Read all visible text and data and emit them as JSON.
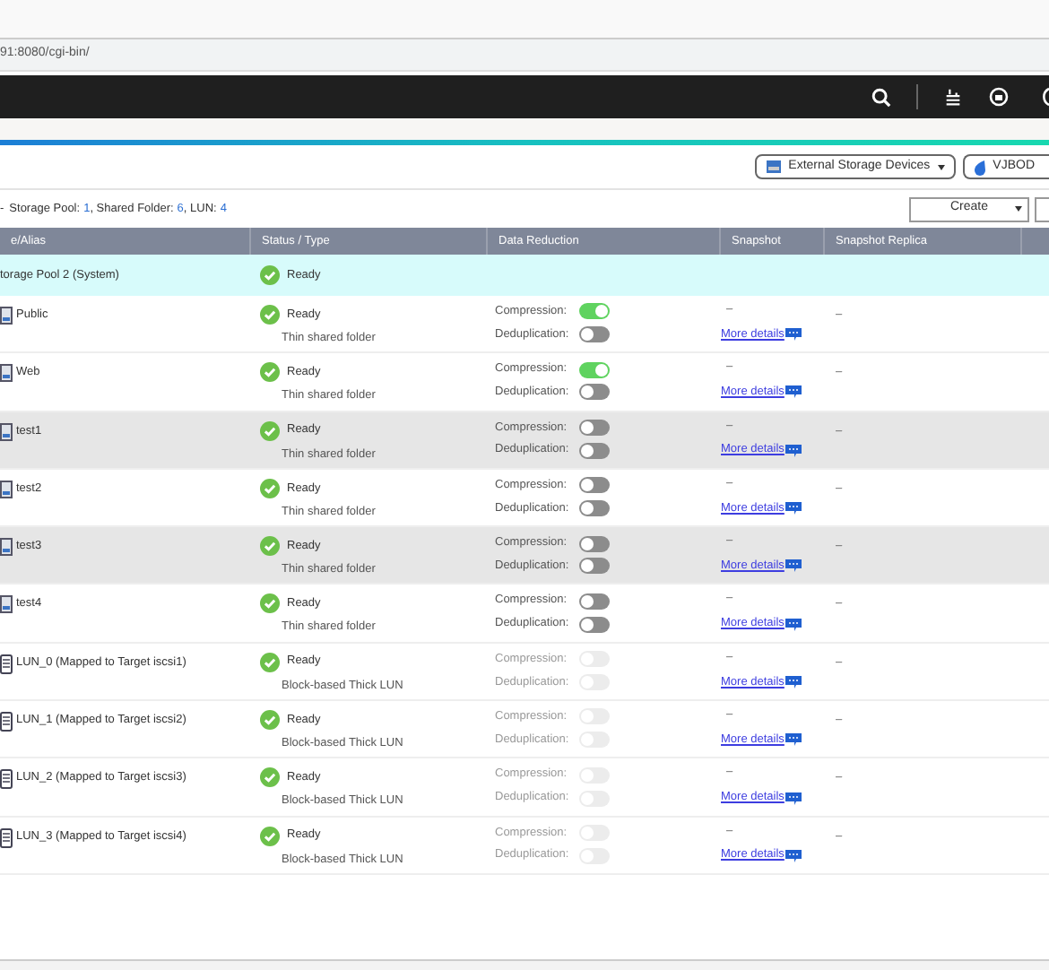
{
  "browser": {
    "url": "91:8080/cgi-bin/"
  },
  "toolbar": {
    "buttons": [
      {
        "label": "External Storage Devices",
        "kind": "external"
      },
      {
        "label": "VJBOD",
        "kind": "vjbod"
      }
    ]
  },
  "summary": {
    "prefix": "-",
    "items": [
      {
        "label": "Storage Pool:",
        "count": "1"
      },
      {
        "label": ", Shared Folder:",
        "count": "6"
      },
      {
        "label": ", LUN:",
        "count": "4"
      }
    ],
    "create": "Create"
  },
  "table": {
    "columns": [
      "e/Alias",
      "Status / Type",
      "Data Reduction",
      "Snapshot",
      "Snapshot Replica"
    ],
    "rows": [
      {
        "kind": "pool",
        "name": "torage Pool 2 (System)",
        "status": "Ready"
      },
      {
        "kind": "folder",
        "name": "Public",
        "status": "Ready",
        "type": "Thin shared folder",
        "compression_label": "Compression:",
        "compression": {
          "on": true,
          "disabled": false
        },
        "dedup_label": "Deduplication:",
        "dedup": {
          "on": false,
          "disabled": false
        },
        "snapshot": "–",
        "details": "More details",
        "replica": "–",
        "selected": false
      },
      {
        "kind": "folder",
        "name": "Web",
        "status": "Ready",
        "type": "Thin shared folder",
        "compression_label": "Compression:",
        "compression": {
          "on": true,
          "disabled": false
        },
        "dedup_label": "Deduplication:",
        "dedup": {
          "on": false,
          "disabled": false
        },
        "snapshot": "–",
        "details": "More details",
        "replica": "–",
        "selected": false
      },
      {
        "kind": "folder",
        "name": "test1",
        "status": "Ready",
        "type": "Thin shared folder",
        "compression_label": "Compression:",
        "compression": {
          "on": false,
          "disabled": false
        },
        "dedup_label": "Deduplication:",
        "dedup": {
          "on": false,
          "disabled": false
        },
        "snapshot": "–",
        "details": "More details",
        "replica": "–",
        "selected": true
      },
      {
        "kind": "folder",
        "name": "test2",
        "status": "Ready",
        "type": "Thin shared folder",
        "compression_label": "Compression:",
        "compression": {
          "on": false,
          "disabled": false
        },
        "dedup_label": "Deduplication:",
        "dedup": {
          "on": false,
          "disabled": false
        },
        "snapshot": "–",
        "details": "More details",
        "replica": "–",
        "selected": false
      },
      {
        "kind": "folder",
        "name": "test3",
        "status": "Ready",
        "type": "Thin shared folder",
        "compression_label": "Compression:",
        "compression": {
          "on": false,
          "disabled": false
        },
        "dedup_label": "Deduplication:",
        "dedup": {
          "on": false,
          "disabled": false
        },
        "snapshot": "–",
        "details": "More details",
        "replica": "–",
        "selected": true
      },
      {
        "kind": "folder",
        "name": "test4",
        "status": "Ready",
        "type": "Thin shared folder",
        "compression_label": "Compression:",
        "compression": {
          "on": false,
          "disabled": false
        },
        "dedup_label": "Deduplication:",
        "dedup": {
          "on": false,
          "disabled": false
        },
        "snapshot": "–",
        "details": "More details",
        "replica": "–",
        "selected": false
      },
      {
        "kind": "lun",
        "name": "LUN_0 (Mapped to Target iscsi1)",
        "status": "Ready",
        "type": "Block-based Thick LUN",
        "compression_label": "Compression:",
        "compression": {
          "on": false,
          "disabled": true
        },
        "dedup_label": "Deduplication:",
        "dedup": {
          "on": false,
          "disabled": true
        },
        "snapshot": "–",
        "details": "More details",
        "replica": "–",
        "selected": false
      },
      {
        "kind": "lun",
        "name": "LUN_1 (Mapped to Target iscsi2)",
        "status": "Ready",
        "type": "Block-based Thick LUN",
        "compression_label": "Compression:",
        "compression": {
          "on": false,
          "disabled": true
        },
        "dedup_label": "Deduplication:",
        "dedup": {
          "on": false,
          "disabled": true
        },
        "snapshot": "–",
        "details": "More details",
        "replica": "–",
        "selected": false
      },
      {
        "kind": "lun",
        "name": "LUN_2 (Mapped to Target iscsi3)",
        "status": "Ready",
        "type": "Block-based Thick LUN",
        "compression_label": "Compression:",
        "compression": {
          "on": false,
          "disabled": true
        },
        "dedup_label": "Deduplication:",
        "dedup": {
          "on": false,
          "disabled": true
        },
        "snapshot": "–",
        "details": "More details",
        "replica": "–",
        "selected": false
      },
      {
        "kind": "lun",
        "name": "LUN_3 (Mapped to Target iscsi4)",
        "status": "Ready",
        "type": "Block-based Thick LUN",
        "compression_label": "Compression:",
        "compression": {
          "on": false,
          "disabled": true
        },
        "dedup_label": "Deduplication:",
        "dedup": {
          "on": false,
          "disabled": true
        },
        "snapshot": "–",
        "details": "More details",
        "replica": "–",
        "selected": false
      }
    ]
  }
}
